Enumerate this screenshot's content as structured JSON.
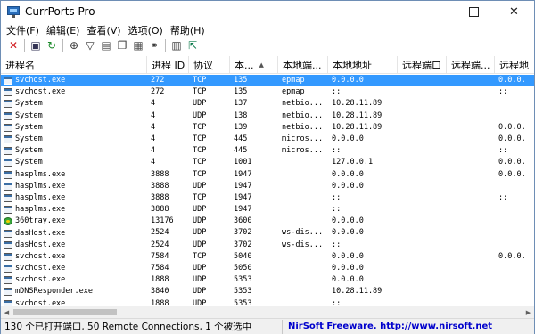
{
  "window": {
    "title": "CurrPorts Pro",
    "controls": {
      "close": "✕"
    }
  },
  "menu": [
    "文件(F)",
    "编辑(E)",
    "查看(V)",
    "选项(O)",
    "帮助(H)"
  ],
  "toolbar": [
    {
      "name": "close-connection-icon",
      "glyph": "✕",
      "color": "#d0161b"
    },
    {
      "name": "save-icon",
      "glyph": "▣",
      "color": "#333355"
    },
    {
      "name": "refresh-icon",
      "glyph": "↻",
      "color": "#1b8a2a"
    },
    {
      "name": "target-icon",
      "glyph": "⊕",
      "color": "#333333"
    },
    {
      "name": "filter-icon",
      "glyph": "▽",
      "color": "#333333"
    },
    {
      "name": "properties-icon",
      "glyph": "▤",
      "color": "#555555"
    },
    {
      "name": "copy-icon",
      "glyph": "❐",
      "color": "#444444"
    },
    {
      "name": "process-icon",
      "glyph": "▦",
      "color": "#555555"
    },
    {
      "name": "find-icon",
      "glyph": "⚭",
      "color": "#333333"
    },
    {
      "name": "report-icon",
      "glyph": "▥",
      "color": "#444444"
    },
    {
      "name": "exit-icon",
      "glyph": "⇱",
      "color": "#0a7a4a"
    }
  ],
  "columns": [
    "进程名",
    "进程 ID",
    "协议",
    "本...",
    "本地端...",
    "本地地址",
    "远程端口",
    "远程端...",
    "远程地"
  ],
  "sort_indicator": "▲",
  "rows": [
    {
      "name": "svchost.exe",
      "pid": "272",
      "proto": "TCP",
      "lport": "135",
      "lportname": "epmap",
      "laddr": "0.0.0.0",
      "rport": "",
      "rportname": "",
      "raddr": "0.0.0.",
      "selected": true,
      "icon": "window"
    },
    {
      "name": "svchost.exe",
      "pid": "272",
      "proto": "TCP",
      "lport": "135",
      "lportname": "epmap",
      "laddr": "::",
      "rport": "",
      "rportname": "",
      "raddr": "::",
      "icon": "window"
    },
    {
      "name": "System",
      "pid": "4",
      "proto": "UDP",
      "lport": "137",
      "lportname": "netbio...",
      "laddr": "10.28.11.89",
      "rport": "",
      "rportname": "",
      "raddr": "",
      "icon": "window"
    },
    {
      "name": "System",
      "pid": "4",
      "proto": "UDP",
      "lport": "138",
      "lportname": "netbio...",
      "laddr": "10.28.11.89",
      "rport": "",
      "rportname": "",
      "raddr": "",
      "icon": "window"
    },
    {
      "name": "System",
      "pid": "4",
      "proto": "TCP",
      "lport": "139",
      "lportname": "netbio...",
      "laddr": "10.28.11.89",
      "rport": "",
      "rportname": "",
      "raddr": "0.0.0.",
      "icon": "window"
    },
    {
      "name": "System",
      "pid": "4",
      "proto": "TCP",
      "lport": "445",
      "lportname": "micros...",
      "laddr": "0.0.0.0",
      "rport": "",
      "rportname": "",
      "raddr": "0.0.0.",
      "icon": "window"
    },
    {
      "name": "System",
      "pid": "4",
      "proto": "TCP",
      "lport": "445",
      "lportname": "micros...",
      "laddr": "::",
      "rport": "",
      "rportname": "",
      "raddr": "::",
      "icon": "window"
    },
    {
      "name": "System",
      "pid": "4",
      "proto": "TCP",
      "lport": "1001",
      "lportname": "",
      "laddr": "127.0.0.1",
      "rport": "",
      "rportname": "",
      "raddr": "0.0.0.",
      "icon": "window"
    },
    {
      "name": "hasplms.exe",
      "pid": "3888",
      "proto": "TCP",
      "lport": "1947",
      "lportname": "",
      "laddr": "0.0.0.0",
      "rport": "",
      "rportname": "",
      "raddr": "0.0.0.",
      "icon": "window"
    },
    {
      "name": "hasplms.exe",
      "pid": "3888",
      "proto": "UDP",
      "lport": "1947",
      "lportname": "",
      "laddr": "0.0.0.0",
      "rport": "",
      "rportname": "",
      "raddr": "",
      "icon": "window"
    },
    {
      "name": "hasplms.exe",
      "pid": "3888",
      "proto": "TCP",
      "lport": "1947",
      "lportname": "",
      "laddr": "::",
      "rport": "",
      "rportname": "",
      "raddr": "::",
      "icon": "window"
    },
    {
      "name": "hasplms.exe",
      "pid": "3888",
      "proto": "UDP",
      "lport": "1947",
      "lportname": "",
      "laddr": "::",
      "rport": "",
      "rportname": "",
      "raddr": "",
      "icon": "window"
    },
    {
      "name": "360tray.exe",
      "pid": "13176",
      "proto": "UDP",
      "lport": "3600",
      "lportname": "",
      "laddr": "0.0.0.0",
      "rport": "",
      "rportname": "",
      "raddr": "",
      "icon": "swirl"
    },
    {
      "name": "dasHost.exe",
      "pid": "2524",
      "proto": "UDP",
      "lport": "3702",
      "lportname": "ws-dis...",
      "laddr": "0.0.0.0",
      "rport": "",
      "rportname": "",
      "raddr": "",
      "icon": "window"
    },
    {
      "name": "dasHost.exe",
      "pid": "2524",
      "proto": "UDP",
      "lport": "3702",
      "lportname": "ws-dis...",
      "laddr": "::",
      "rport": "",
      "rportname": "",
      "raddr": "",
      "icon": "window"
    },
    {
      "name": "svchost.exe",
      "pid": "7584",
      "proto": "TCP",
      "lport": "5040",
      "lportname": "",
      "laddr": "0.0.0.0",
      "rport": "",
      "rportname": "",
      "raddr": "0.0.0.",
      "icon": "window"
    },
    {
      "name": "svchost.exe",
      "pid": "7584",
      "proto": "UDP",
      "lport": "5050",
      "lportname": "",
      "laddr": "0.0.0.0",
      "rport": "",
      "rportname": "",
      "raddr": "",
      "icon": "window"
    },
    {
      "name": "svchost.exe",
      "pid": "1888",
      "proto": "UDP",
      "lport": "5353",
      "lportname": "",
      "laddr": "0.0.0.0",
      "rport": "",
      "rportname": "",
      "raddr": "",
      "icon": "window"
    },
    {
      "name": "mDNSResponder.exe",
      "pid": "3840",
      "proto": "UDP",
      "lport": "5353",
      "lportname": "",
      "laddr": "10.28.11.89",
      "rport": "",
      "rportname": "",
      "raddr": "",
      "icon": "window"
    },
    {
      "name": "svchost.exe",
      "pid": "1888",
      "proto": "UDP",
      "lport": "5353",
      "lportname": "",
      "laddr": "::",
      "rport": "",
      "rportname": "",
      "raddr": "",
      "icon": "window"
    }
  ],
  "scrollbar": {
    "left": "◀",
    "right": "▶"
  },
  "status": {
    "left": "130 个已打开端口, 50 Remote Connections, 1 个被选中",
    "right": "NirSoft Freeware.  http://www.nirsoft.net"
  },
  "colors": {
    "selection": "#3399ff",
    "status_link": "#0000cc"
  }
}
